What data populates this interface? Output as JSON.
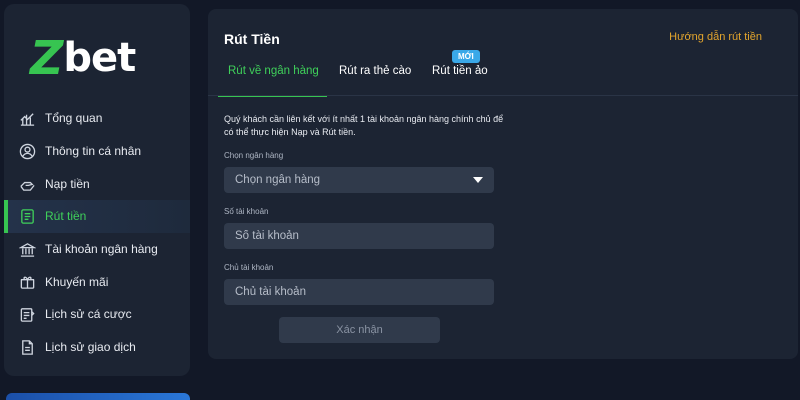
{
  "brand": {
    "logo_part1": "Z",
    "logo_part2": "bet",
    "accent_color": "#37c451"
  },
  "sidebar": {
    "items": [
      {
        "label": "Tổng quan",
        "icon": "dashboard-icon",
        "active": false
      },
      {
        "label": "Thông tin cá nhân",
        "icon": "user-icon",
        "active": false
      },
      {
        "label": "Nạp tiền",
        "icon": "deposit-icon",
        "active": false
      },
      {
        "label": "Rút tiền",
        "icon": "withdraw-icon",
        "active": true
      },
      {
        "label": "Tài khoản ngân hàng",
        "icon": "bank-icon",
        "active": false
      },
      {
        "label": "Khuyến mãi",
        "icon": "gift-icon",
        "active": false
      },
      {
        "label": "Lịch sử cá cược",
        "icon": "bet-history-icon",
        "active": false
      },
      {
        "label": "Lịch sử giao dịch",
        "icon": "transaction-history-icon",
        "active": false
      }
    ]
  },
  "panel": {
    "title": "Rút Tiền",
    "guide_link": "Hướng dẫn rút tiền",
    "tabs": [
      {
        "label": "Rút về ngân hàng",
        "active": true
      },
      {
        "label": "Rút ra thẻ cào",
        "active": false
      },
      {
        "label": "Rút tiền ảo",
        "active": false,
        "badge": "MỚI"
      }
    ],
    "notice": "Quý khách cần liên kết với ít nhất 1 tài khoản ngân hàng chính chủ để có thể thực hiện Nạp và Rút tiền.",
    "form": {
      "bank_label": "Chọn ngân hàng",
      "bank_placeholder": "Chọn ngân hàng",
      "account_number_label": "Số tài khoản",
      "account_number_placeholder": "Số tài khoản",
      "account_holder_label": "Chủ tài khoản",
      "account_holder_placeholder": "Chủ tài khoản",
      "submit_label": "Xác nhận"
    }
  },
  "colors": {
    "background": "#121827",
    "panel": "#1c2433",
    "input": "#303a4b",
    "link": "#e3a52d",
    "badge": "#3aa8e8"
  }
}
